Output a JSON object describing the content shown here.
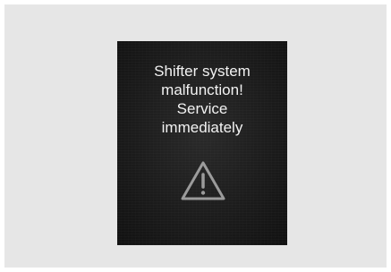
{
  "display": {
    "message_lines": [
      "Shifter system",
      "malfunction!",
      "Service",
      "immediately"
    ],
    "icon": "warning-triangle-icon",
    "colors": {
      "background": "#1c1c1c",
      "text": "#f2f2f2",
      "icon": "#9a9a9a",
      "frame": "#e6e6e6"
    }
  }
}
